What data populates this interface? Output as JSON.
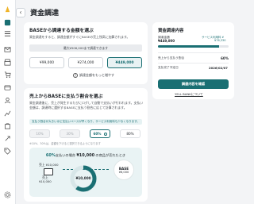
{
  "header": {
    "title": "資金調達",
    "back_icon": "chevron-left-icon"
  },
  "sidebar": {
    "icons": [
      "logo-icon",
      "home-icon",
      "menu-icon",
      "mail-icon",
      "store-icon",
      "cart-icon",
      "card-icon",
      "users-icon",
      "chart-icon",
      "bag-icon",
      "link-icon",
      "tag-icon",
      "gear-icon"
    ]
  },
  "amount_section": {
    "title": "BASEから調達する金額を選ぶ",
    "desc": "資金調達をすると、調達金額がすぐにBASEの売上残高に加算されます。",
    "max_text": "最大¥506,000まで調達できます",
    "options": [
      "¥99,000",
      "¥274,000",
      "¥449,000"
    ],
    "selected_index": 2,
    "more_text": "調達金額をもっと増やす"
  },
  "payback_section": {
    "title": "売上からBASEに支払う割合を選ぶ",
    "desc": "資金調達後に、売上が発生するたびにログして自動で支払いが行われます。支払い金額は、調達時に選択するBASEに支払う割合に応じて計算されます。",
    "notice": "支払う割合が大きいほど支払いペースが早くなり、サービス利用料も少なくなります。",
    "options": [
      "10%",
      "30%",
      "60%",
      "80%"
    ],
    "disabled": [
      true,
      true,
      false,
      false
    ],
    "selected_index": 2,
    "note": "※10%、30%は、金額を下げると選択できるようになります",
    "sim": {
      "pct": "60%",
      "mid": "支払いの場合 ",
      "amount": "¥10,000",
      "tail": " の商品が売れたとき",
      "sales_label": "売上 ¥10,000",
      "sales_sub_1": "売上",
      "sales_sub_2": "¥10,000",
      "donut_center": "¥10,000",
      "base_name": "BASE",
      "base_amount": "¥6,000",
      "share": 0.6
    }
  },
  "summary": {
    "title": "資金調達内容",
    "amount_label": "調達金額",
    "amount_value": "¥449,000",
    "fee_label": "サービス利用料 ¥",
    "fee_value": "¥76,330",
    "rate_label": "売上から支払う割合",
    "rate_value": "60%",
    "date_label": "支払完了予定日",
    "date_value": "2026/02/07",
    "progress": 0.86,
    "confirm_button": "調達内容を確認",
    "yell_link": "YELL BANKについて"
  },
  "colors": {
    "accent": "#1a6f73",
    "light_accent": "#e8f2f3",
    "background": "#f3f4f6"
  }
}
